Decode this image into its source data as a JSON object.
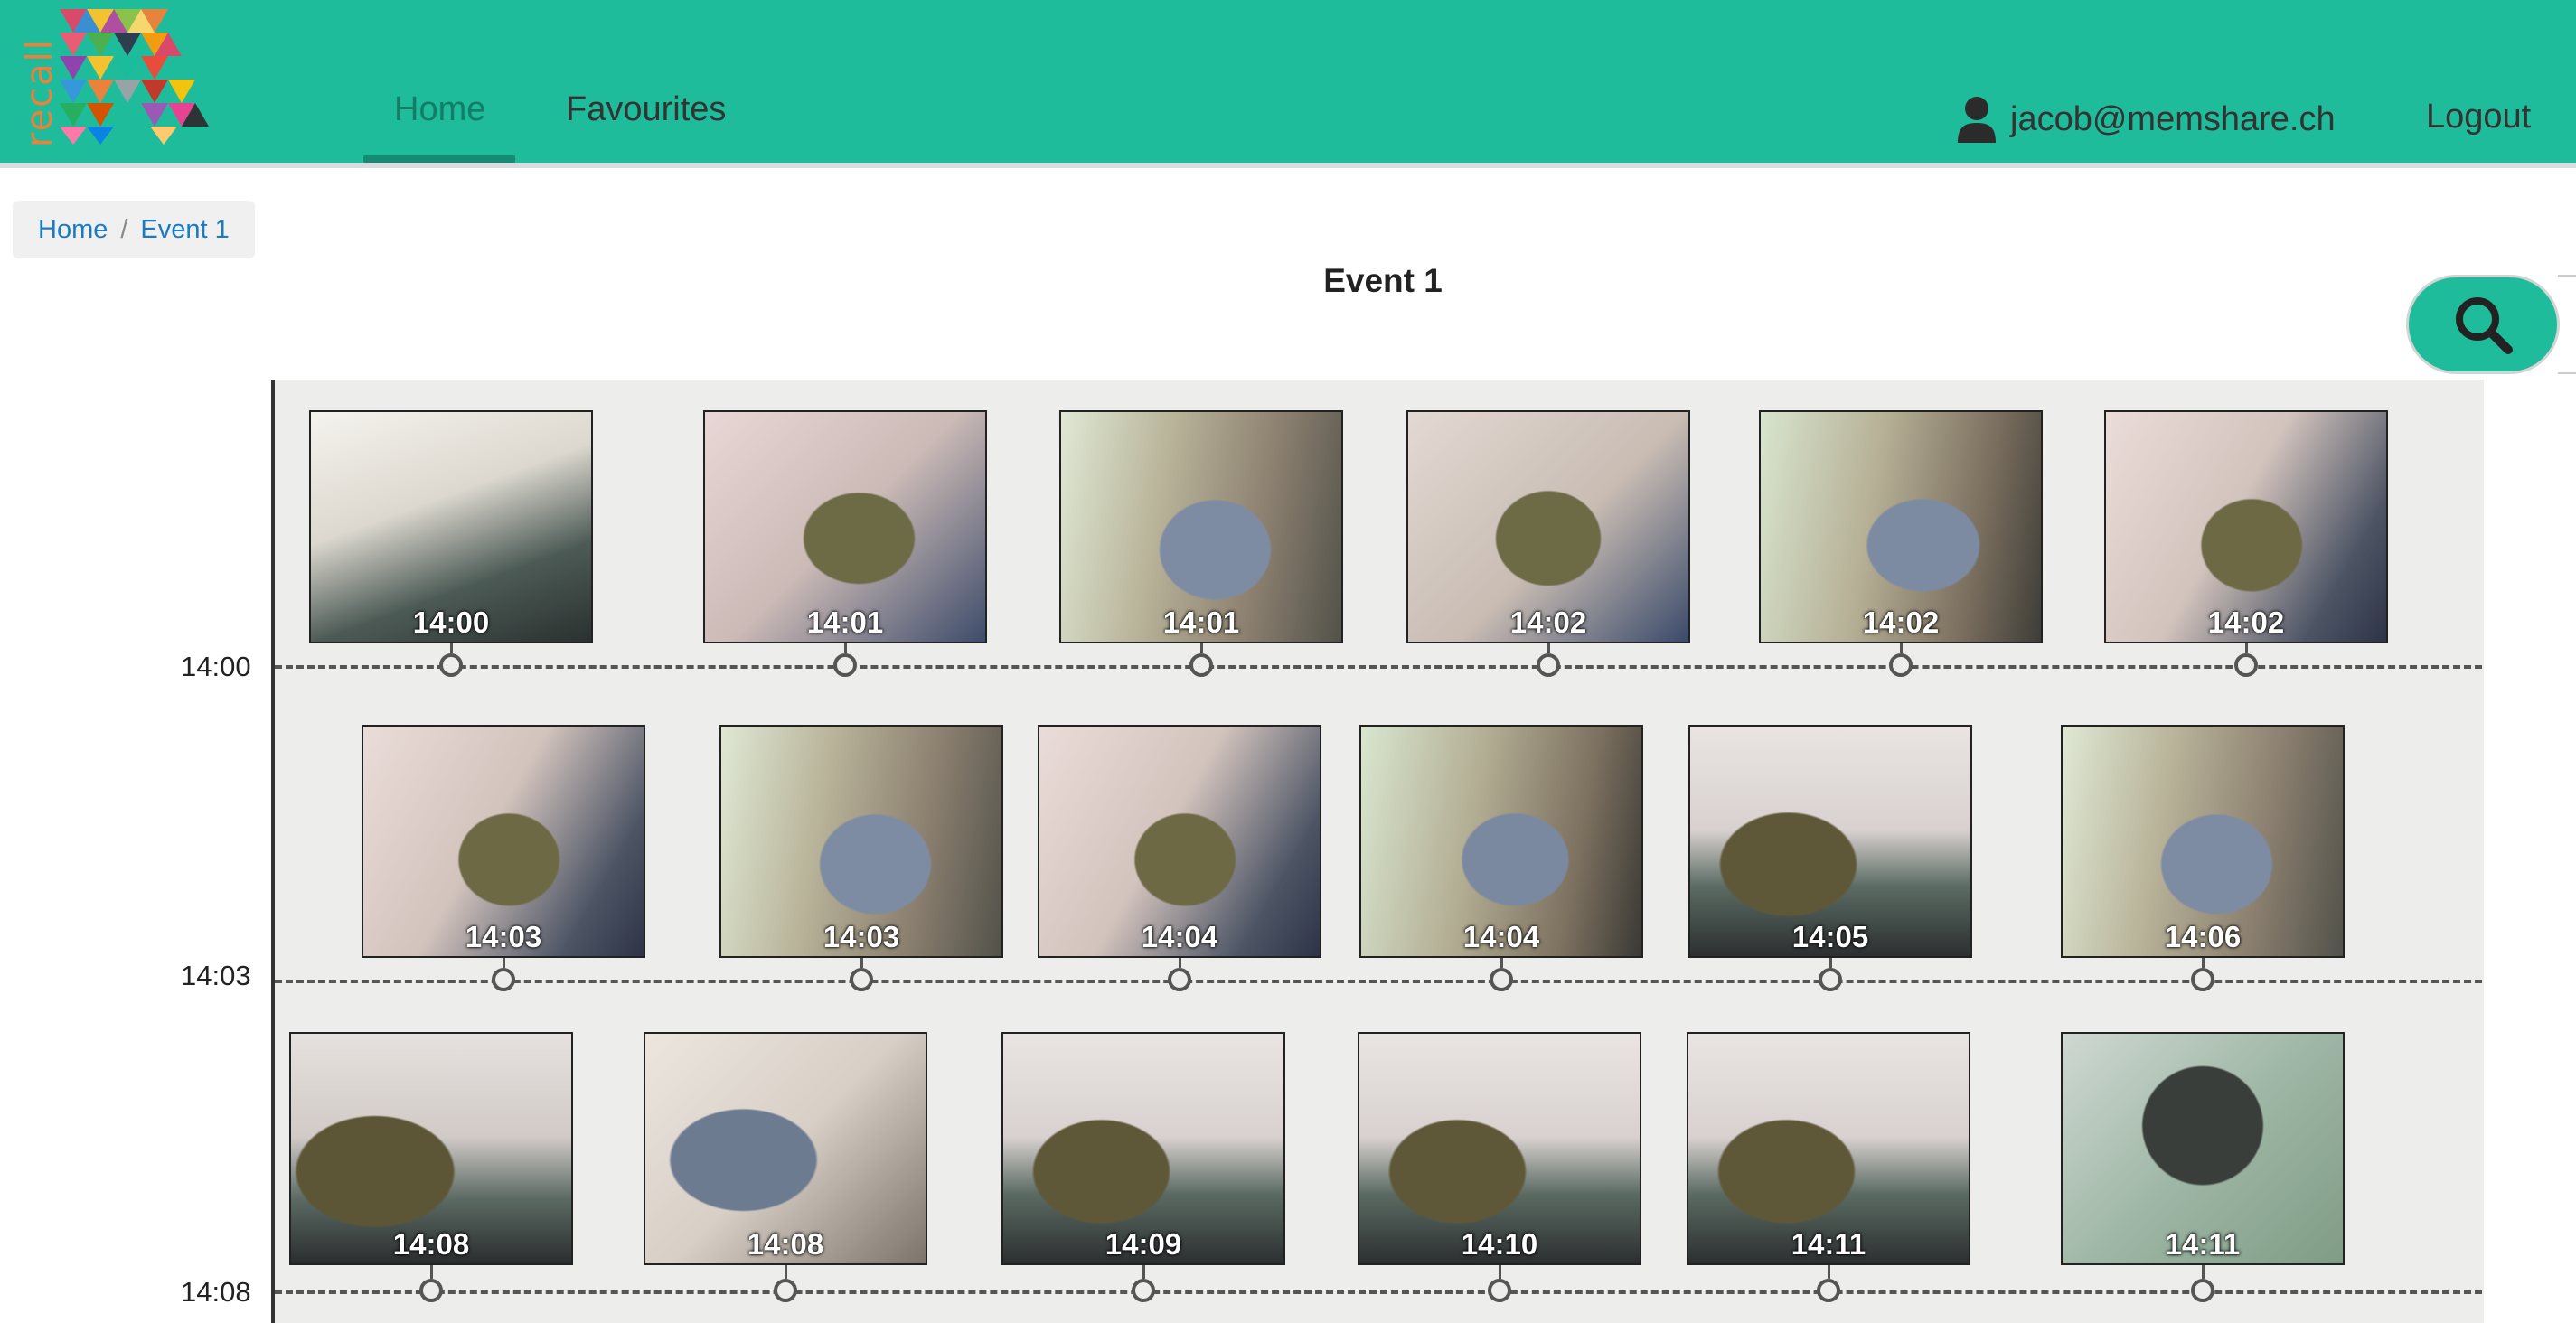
{
  "nav": {
    "logo_text": "recall",
    "tabs": [
      {
        "label": "Home",
        "active": true
      },
      {
        "label": "Favourites",
        "active": false
      }
    ],
    "user_email": "jacob@memshare.ch",
    "logout_label": "Logout",
    "accent_color": "#1fbc9b"
  },
  "breadcrumb": [
    {
      "label": "Home"
    },
    {
      "label": "Event 1"
    }
  ],
  "page_title": "Event 1",
  "search_icon": "search-icon",
  "rows": [
    {
      "time_label": "14:00",
      "photos": [
        {
          "time": "14:00",
          "scene": "office-laptop"
        },
        {
          "time": "14:01",
          "scene": "man-orange-collar-reclining"
        },
        {
          "time": "14:01",
          "scene": "man-blue-shirt-window"
        },
        {
          "time": "14:02",
          "scene": "man-orange-collar-arms-crossed"
        },
        {
          "time": "14:02",
          "scene": "man-blue-shirt-gesturing"
        },
        {
          "time": "14:02",
          "scene": "man-orange-collar-seated"
        }
      ]
    },
    {
      "time_label": "14:03",
      "photos": [
        {
          "time": "14:03",
          "scene": "man-orange-collar-seated"
        },
        {
          "time": "14:03",
          "scene": "man-blue-shirt-window"
        },
        {
          "time": "14:04",
          "scene": "man-orange-collar-seated"
        },
        {
          "time": "14:04",
          "scene": "man-blue-shirt-thinking"
        },
        {
          "time": "14:05",
          "scene": "man-orange-collar-classroom"
        },
        {
          "time": "14:06",
          "scene": "man-blue-shirt-window"
        }
      ]
    },
    {
      "time_label": "14:08",
      "photos": [
        {
          "time": "14:08",
          "scene": "man-orange-collar-talking"
        },
        {
          "time": "14:08",
          "scene": "man-blue-shirt-close"
        },
        {
          "time": "14:09",
          "scene": "man-orange-collar-classroom"
        },
        {
          "time": "14:10",
          "scene": "man-orange-collar-classroom"
        },
        {
          "time": "14:11",
          "scene": "man-orange-collar-classroom"
        },
        {
          "time": "14:11",
          "scene": "backpack-on-desk"
        }
      ]
    }
  ]
}
